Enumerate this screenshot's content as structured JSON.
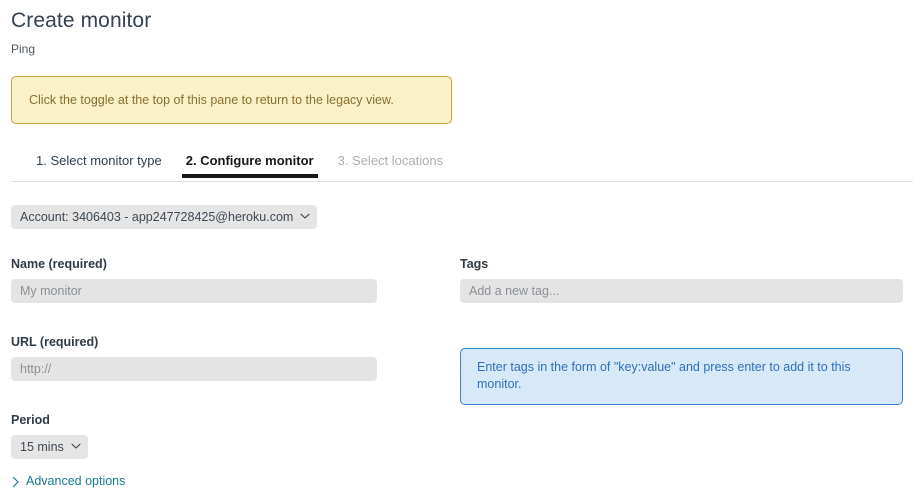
{
  "header": {
    "title": "Create monitor",
    "subtitle": "Ping"
  },
  "banner": {
    "text": "Click the toggle at the top of this pane to return to the legacy view.",
    "bg_color": "#fbf1c8",
    "border_color": "#c6a43f",
    "text_color": "#8a6d2f"
  },
  "tabs": [
    {
      "label": "1. Select monitor type",
      "state": "done"
    },
    {
      "label": "2. Configure monitor",
      "state": "active"
    },
    {
      "label": "3. Select locations",
      "state": "disabled"
    }
  ],
  "account": {
    "label": "Account: 3406403 - app247728425@heroku.com",
    "chevron_icon": "chevron-down-icon"
  },
  "form": {
    "name": {
      "label": "Name (required)",
      "value": "",
      "placeholder": "My monitor"
    },
    "url": {
      "label": "URL (required)",
      "value": "",
      "placeholder": "http://"
    },
    "period": {
      "label": "Period",
      "value": "15 mins",
      "chevron_icon": "chevron-down-icon"
    },
    "tags": {
      "label": "Tags",
      "value": "",
      "placeholder": "Add a new tag..."
    },
    "advanced": {
      "label": "Advanced options",
      "caret_icon": "chevron-right-icon",
      "link_color": "#1a7a8c"
    }
  },
  "info_box": {
    "text": "Enter tags in the form of \"key:value\" and press enter to add it to this monitor.",
    "bg_color": "#d7e9f9",
    "border_color": "#3a82c6",
    "text_color": "#2f6fb5"
  }
}
